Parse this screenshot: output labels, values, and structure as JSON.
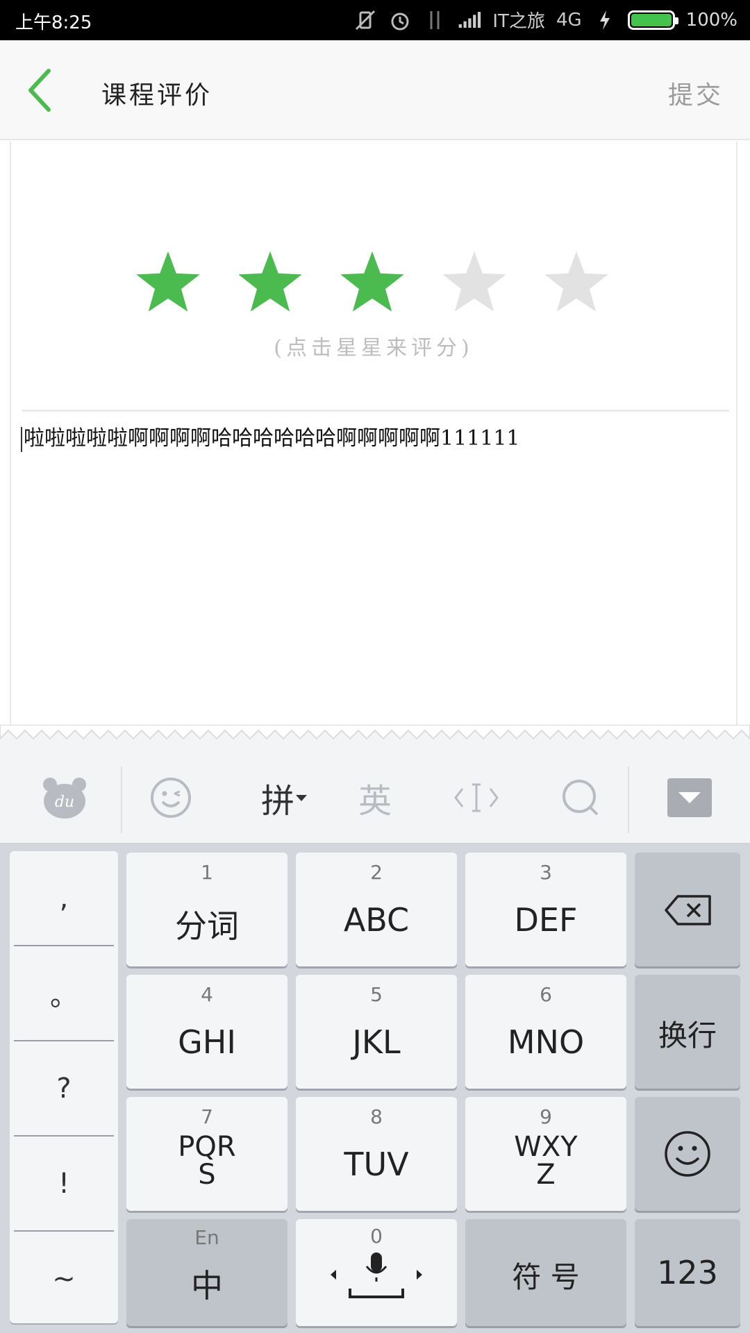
{
  "status_bar": {
    "time": "上午8:25",
    "carrier": "IT之旅",
    "network": "4G",
    "battery": "100%",
    "battery_level": 1.0
  },
  "header": {
    "title": "课程评价",
    "submit_label": "提交"
  },
  "rating": {
    "value": 3,
    "max": 5,
    "hint": "(点击星星来评分)",
    "active_color": "#4cbb4f",
    "inactive_color": "#e2e2e2"
  },
  "comment": {
    "text": "啦啦啦啦啦啊啊啊啊哈哈哈哈哈哈啊啊啊啊啊111111"
  },
  "keyboard": {
    "toolbar": {
      "pinyin": "拼",
      "english": "英"
    },
    "punctuation": [
      ",",
      "。",
      "?",
      "!",
      "~"
    ],
    "keys": [
      {
        "num": "1",
        "label": "分词"
      },
      {
        "num": "2",
        "label": "ABC"
      },
      {
        "num": "3",
        "label": "DEF"
      },
      {
        "num": "4",
        "label": "GHI"
      },
      {
        "num": "5",
        "label": "JKL"
      },
      {
        "num": "6",
        "label": "MNO"
      },
      {
        "num": "7",
        "label": "PQR",
        "label2": "S"
      },
      {
        "num": "8",
        "label": "TUV"
      },
      {
        "num": "9",
        "label": "WXY",
        "label2": "Z"
      }
    ],
    "enter_label": "换行",
    "lang_small": "En",
    "lang_label": "中",
    "space_num": "0",
    "symbol_label": "符 号",
    "numbers_label": "123"
  }
}
